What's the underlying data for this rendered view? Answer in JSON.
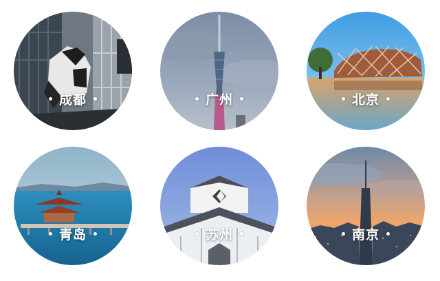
{
  "cities": [
    {
      "name": "成都",
      "image": "chengdu-panda-building-image"
    },
    {
      "name": "广州",
      "image": "guangzhou-canton-tower-image"
    },
    {
      "name": "北京",
      "image": "beijing-birds-nest-stadium-image"
    },
    {
      "name": "青岛",
      "image": "qingdao-pier-pavilion-image"
    },
    {
      "name": "苏州",
      "image": "suzhou-museum-image"
    },
    {
      "name": "南京",
      "image": "nanjing-skyline-tower-image"
    }
  ],
  "colors": {
    "caption": "#ffffff",
    "background": "#ffffff"
  }
}
